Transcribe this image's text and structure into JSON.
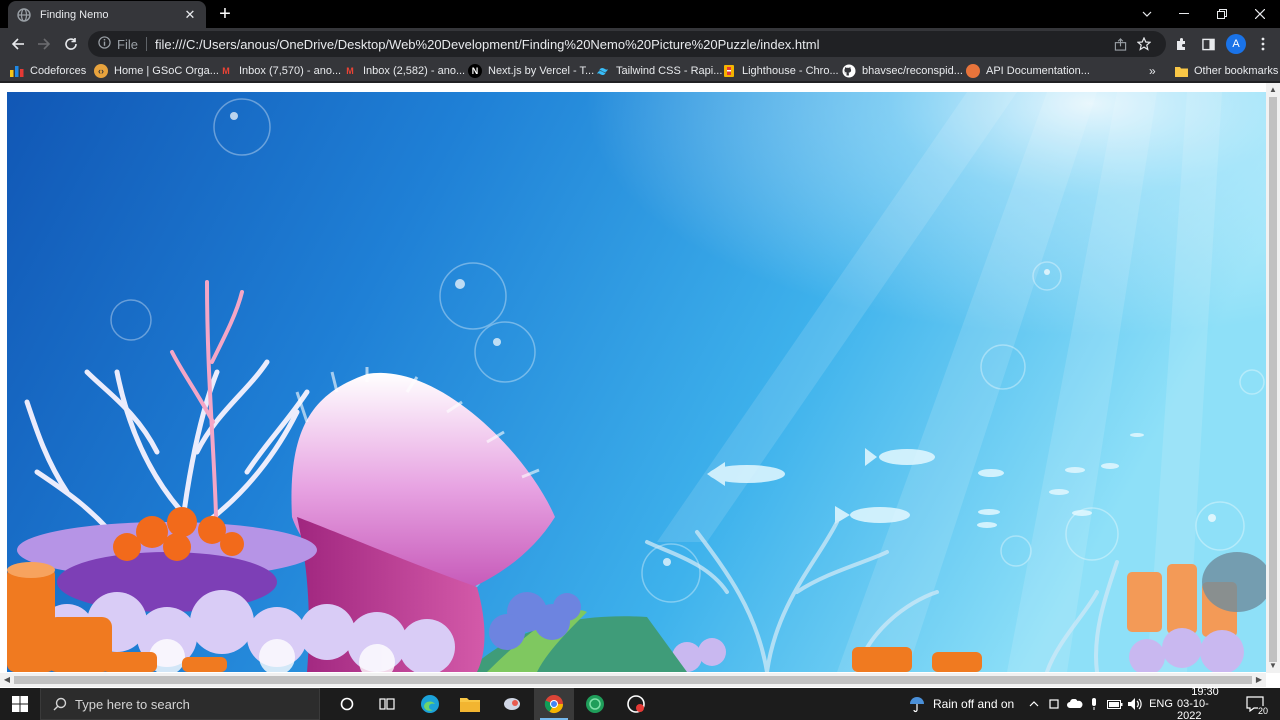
{
  "browser": {
    "tab": {
      "title": "Finding Nemo",
      "favicon": "globe-icon"
    },
    "new_tab_label": "+",
    "omnibox": {
      "scheme": "File",
      "url": "file:///C:/Users/anous/OneDrive/Desktop/Web%20Development/Finding%20Nemo%20Picture%20Puzzle/index.html"
    },
    "profile_initial": "A",
    "bookmarks": [
      {
        "label": "Codeforces",
        "icon": "codeforces-icon",
        "color": "#f5c518"
      },
      {
        "label": "Home | GSoC Orga...",
        "icon": "gsoc-icon",
        "color": "#e8a33d"
      },
      {
        "label": "Inbox (7,570) - ano...",
        "icon": "gmail-icon",
        "color": "#ea4335"
      },
      {
        "label": "Inbox (2,582) - ano...",
        "icon": "gmail-icon",
        "color": "#ea4335"
      },
      {
        "label": "Next.js by Vercel - T...",
        "icon": "nextjs-icon",
        "color": "#000000"
      },
      {
        "label": "Tailwind CSS - Rapi...",
        "icon": "tailwind-icon",
        "color": "#38bdf8"
      },
      {
        "label": "Lighthouse - Chro...",
        "icon": "lighthouse-icon",
        "color": "#f4b400"
      },
      {
        "label": "bhavsec/reconspid...",
        "icon": "github-icon",
        "color": "#ffffff"
      },
      {
        "label": "API Documentation...",
        "icon": "api-doc-icon",
        "color": "#e8743b"
      }
    ],
    "overflow_label": "»",
    "other_bookmarks": "Other bookmarks"
  },
  "taskbar": {
    "search_placeholder": "Type here to search",
    "weather": "Rain off and on",
    "language": "ENG",
    "time": "19:30",
    "date": "03-10-2022",
    "notification_count": "20"
  }
}
